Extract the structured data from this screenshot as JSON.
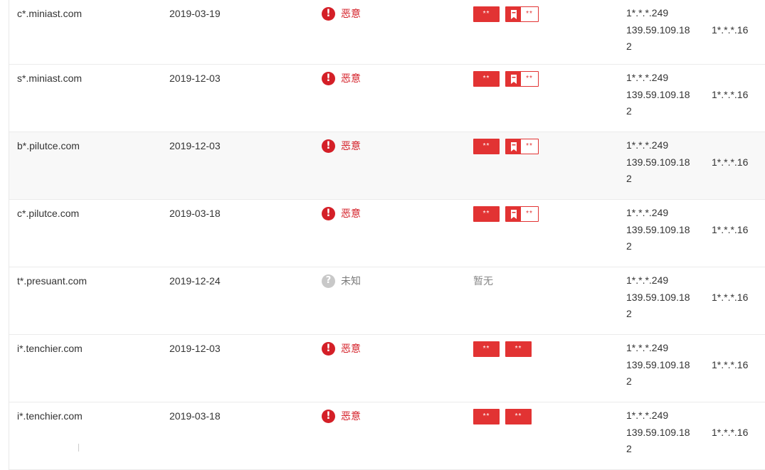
{
  "status_colors": {
    "malicious": "#d41f27",
    "unknown": "#c8c8c8",
    "tag": "#e23333"
  },
  "rows": [
    {
      "domain": "c*.miniast.com",
      "date": "2019-03-19",
      "status": "恶意",
      "status_icon": "!",
      "tags": [
        {
          "label": "**"
        },
        {
          "label": "**",
          "bookmark": true
        }
      ],
      "ip1": "1*.*.*.249",
      "ip2a": "139.59.109.18",
      "ip2b": "1*.*.*.16",
      "ip3": "2"
    },
    {
      "domain": "s*.miniast.com",
      "date": "2019-12-03",
      "status": "恶意",
      "status_icon": "!",
      "tags": [
        {
          "label": "**"
        },
        {
          "label": "**",
          "bookmark": true
        }
      ],
      "ip1": "1*.*.*.249",
      "ip2a": "139.59.109.18",
      "ip2b": "1*.*.*.16",
      "ip3": "2"
    },
    {
      "domain": "b*.pilutce.com",
      "date": "2019-12-03",
      "status": "恶意",
      "status_icon": "!",
      "tags": [
        {
          "label": "**"
        },
        {
          "label": "**",
          "bookmark": true
        }
      ],
      "ip1": "1*.*.*.249",
      "ip2a": "139.59.109.18",
      "ip2b": "1*.*.*.16",
      "ip3": "2"
    },
    {
      "domain": "c*.pilutce.com",
      "date": "2019-03-18",
      "status": "恶意",
      "status_icon": "!",
      "tags": [
        {
          "label": "**"
        },
        {
          "label": "**",
          "bookmark": true
        }
      ],
      "ip1": "1*.*.*.249",
      "ip2a": "139.59.109.18",
      "ip2b": "1*.*.*.16",
      "ip3": "2"
    },
    {
      "domain": "t*.presuant.com",
      "date": "2019-12-24",
      "status": "未知",
      "status_icon": "?",
      "none_text": "暂无",
      "ip1": "1*.*.*.249",
      "ip2a": "139.59.109.18",
      "ip2b": "1*.*.*.16",
      "ip3": "2"
    },
    {
      "domain": "i*.tenchier.com",
      "date": "2019-12-03",
      "status": "恶意",
      "status_icon": "!",
      "tags": [
        {
          "label": "**"
        },
        {
          "label": "**"
        }
      ],
      "ip1": "1*.*.*.249",
      "ip2a": "139.59.109.18",
      "ip2b": "1*.*.*.16",
      "ip3": "2"
    },
    {
      "domain": "i*.tenchier.com",
      "date": "2019-03-18",
      "status": "恶意",
      "status_icon": "!",
      "tags": [
        {
          "label": "**"
        },
        {
          "label": "**"
        }
      ],
      "ip1": "1*.*.*.249",
      "ip2a": "139.59.109.18",
      "ip2b": "1*.*.*.16",
      "ip3": "2"
    }
  ]
}
